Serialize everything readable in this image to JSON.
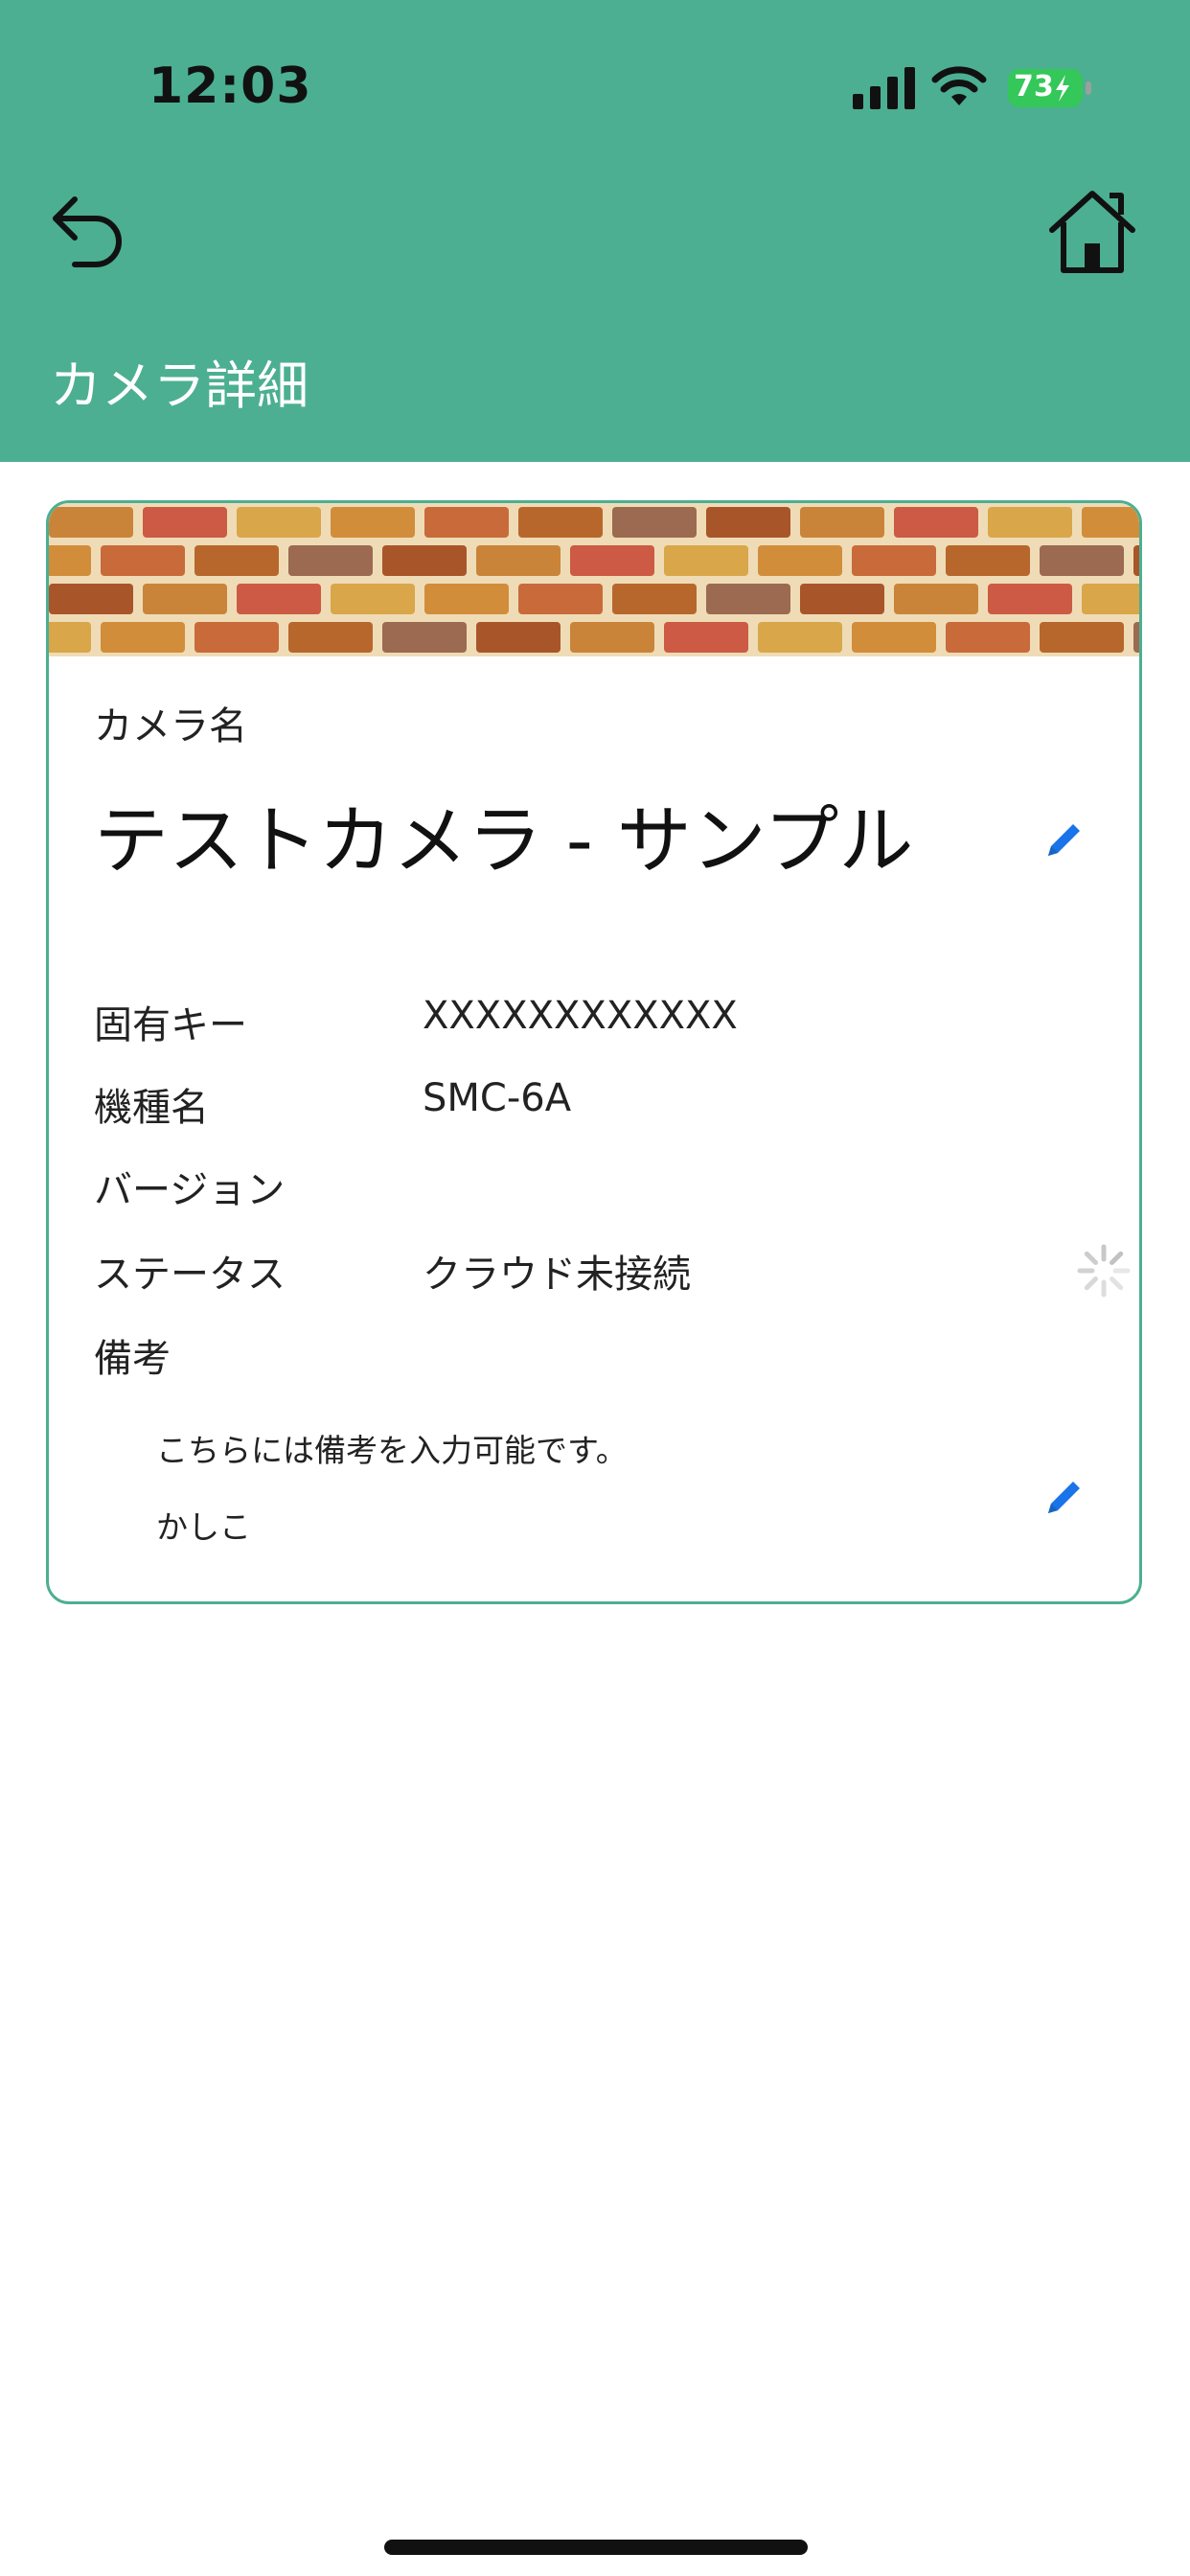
{
  "status_bar": {
    "time": "12:03",
    "battery": "73"
  },
  "header": {
    "title": "カメラ詳細"
  },
  "card": {
    "camera_name_label": "カメラ名",
    "camera_name": "テストカメラ - サンプル",
    "rows": [
      {
        "label": "固有キー",
        "value": "XXXXXXXXXXXX"
      },
      {
        "label": "機種名",
        "value": "SMC-6A"
      },
      {
        "label": "バージョン",
        "value": ""
      },
      {
        "label": "ステータス",
        "value": "クラウド未接続"
      }
    ],
    "memo_label": "備考",
    "memo_lines": [
      "こちらには備考を入力可能です。",
      "かしこ"
    ]
  },
  "colors": {
    "header_bg": "#4caf92",
    "accent": "#1a73e8",
    "battery_green": "#34c759"
  },
  "icons": {
    "back": "back-arrow-icon",
    "home": "home-icon",
    "edit": "pencil-icon",
    "loading": "spinner-icon",
    "signal": "signal-icon",
    "wifi": "wifi-icon",
    "battery": "battery-icon"
  }
}
